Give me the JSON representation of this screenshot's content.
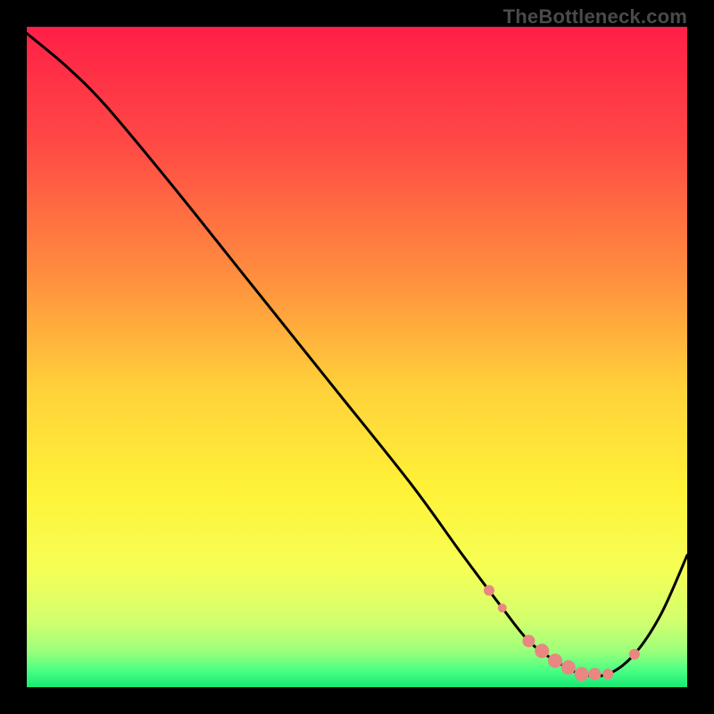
{
  "watermark": "TheBottleneck.com",
  "chart_data": {
    "type": "line",
    "title": "",
    "xlabel": "",
    "ylabel": "",
    "xlim": [
      0,
      100
    ],
    "ylim": [
      0,
      100
    ],
    "grid": false,
    "y_axis_semantics": "bottleneck_percent_higher_is_worse",
    "background_gradient_stops": [
      {
        "pos": 0.0,
        "color": "#ff1f47"
      },
      {
        "pos": 0.18,
        "color": "#ff4a45"
      },
      {
        "pos": 0.38,
        "color": "#ff8f3e"
      },
      {
        "pos": 0.55,
        "color": "#ffd23a"
      },
      {
        "pos": 0.7,
        "color": "#fff238"
      },
      {
        "pos": 0.82,
        "color": "#f6ff55"
      },
      {
        "pos": 0.9,
        "color": "#d2ff6e"
      },
      {
        "pos": 0.945,
        "color": "#9dff7a"
      },
      {
        "pos": 0.975,
        "color": "#49ff84"
      },
      {
        "pos": 1.0,
        "color": "#17e873"
      }
    ],
    "series": [
      {
        "name": "bottleneck-curve",
        "x": [
          0,
          6,
          12,
          22,
          34,
          46,
          58,
          66,
          72,
          76,
          80,
          84,
          88,
          92,
          96,
          100
        ],
        "y": [
          99,
          94,
          88,
          76,
          61,
          46,
          31,
          20,
          12,
          7,
          4,
          2,
          2,
          5,
          11,
          20
        ]
      }
    ],
    "optimal_markers": {
      "name": "optimal-range-dots",
      "color": "#e98782",
      "x": [
        70,
        72,
        76,
        78,
        80,
        82,
        84,
        86,
        88,
        92
      ],
      "r": [
        6,
        5,
        7,
        8,
        8,
        8,
        8,
        7,
        6,
        6
      ]
    }
  }
}
